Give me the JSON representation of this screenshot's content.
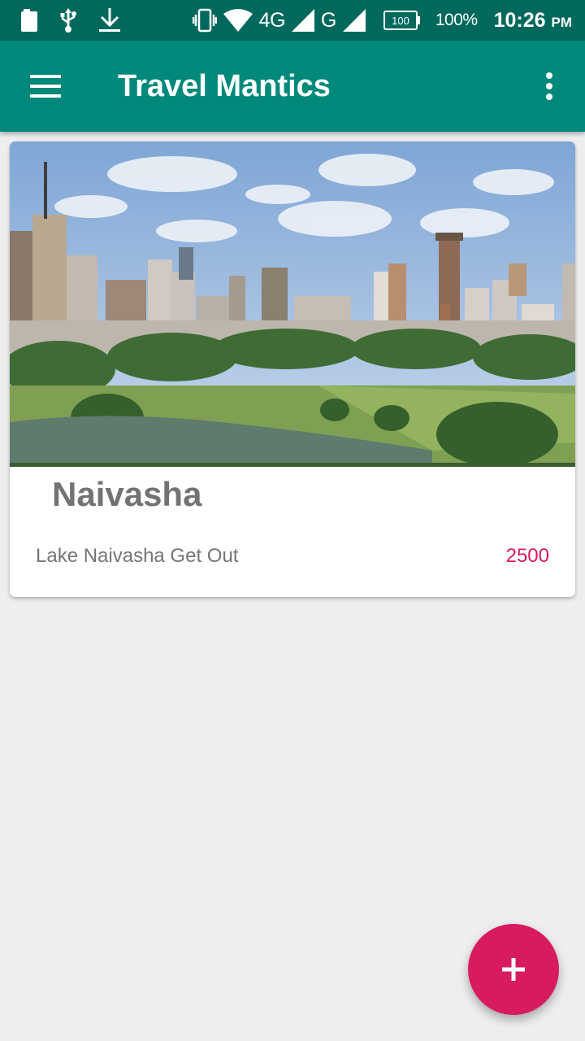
{
  "status_bar": {
    "network_4g": "4G",
    "network_g": "G",
    "battery_level": "100",
    "battery_percent": "100%",
    "time": "10:26",
    "time_suffix": "PM"
  },
  "app_bar": {
    "title": "Travel Mantics",
    "menu_icon": "hamburger-menu-icon",
    "overflow_icon": "more-vert-icon"
  },
  "deals": [
    {
      "title": "Naivasha",
      "description": "Lake Naivasha Get Out",
      "price": "2500"
    }
  ],
  "fab": {
    "icon": "add-icon"
  },
  "colors": {
    "status_bar": "#00695c",
    "primary": "#00897b",
    "accent": "#d81b60",
    "background": "#eeeeee"
  }
}
